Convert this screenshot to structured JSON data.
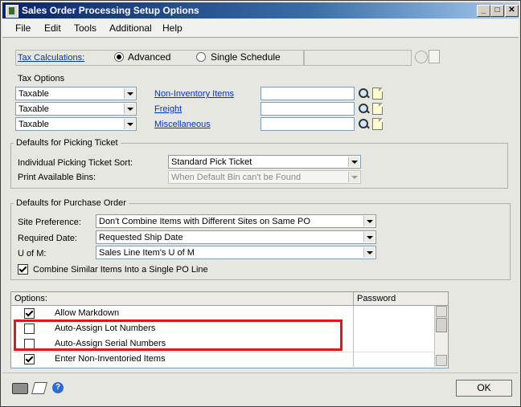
{
  "window": {
    "title": "Sales Order Processing Setup Options"
  },
  "menu": [
    "File",
    "Edit",
    "Tools",
    "Additional",
    "Help"
  ],
  "tax": {
    "calc_label": "Tax Calculations:",
    "advanced_label": "Advanced",
    "single_label": "Single Schedule",
    "selected": "Advanced",
    "options_label": "Tax Options",
    "rows": [
      {
        "value": "Taxable",
        "link": "Non-Inventory Items"
      },
      {
        "value": "Taxable",
        "link": "Freight"
      },
      {
        "value": "Taxable",
        "link": "Miscellaneous"
      }
    ]
  },
  "picking": {
    "group_title": "Defaults for Picking Ticket",
    "sort_label": "Individual Picking Ticket Sort:",
    "sort_value": "Standard Pick Ticket",
    "bins_label": "Print Available Bins:",
    "bins_value": "When Default Bin can't be Found"
  },
  "purchase": {
    "group_title": "Defaults for Purchase Order",
    "site_label": "Site Preference:",
    "site_value": "Don't Combine Items with Different Sites on Same PO",
    "date_label": "Required Date:",
    "date_value": "Requested Ship Date",
    "uom_label": "U of M:",
    "uom_value": "Sales Line Item's U of M",
    "combine_label": "Combine Similar Items Into a Single PO Line",
    "combine_checked": true
  },
  "options": {
    "header_options": "Options:",
    "header_password": "Password",
    "rows": [
      {
        "label": "Allow Markdown",
        "checked": true
      },
      {
        "label": "Auto-Assign Lot Numbers",
        "checked": false
      },
      {
        "label": "Auto-Assign Serial Numbers",
        "checked": false
      },
      {
        "label": "Enter Non-Inventoried Items",
        "checked": true
      }
    ]
  },
  "ok_label": "OK",
  "colors": {
    "title_bar": "#0a246a",
    "link": "#0033cc",
    "highlight_box": "#e3151b"
  }
}
